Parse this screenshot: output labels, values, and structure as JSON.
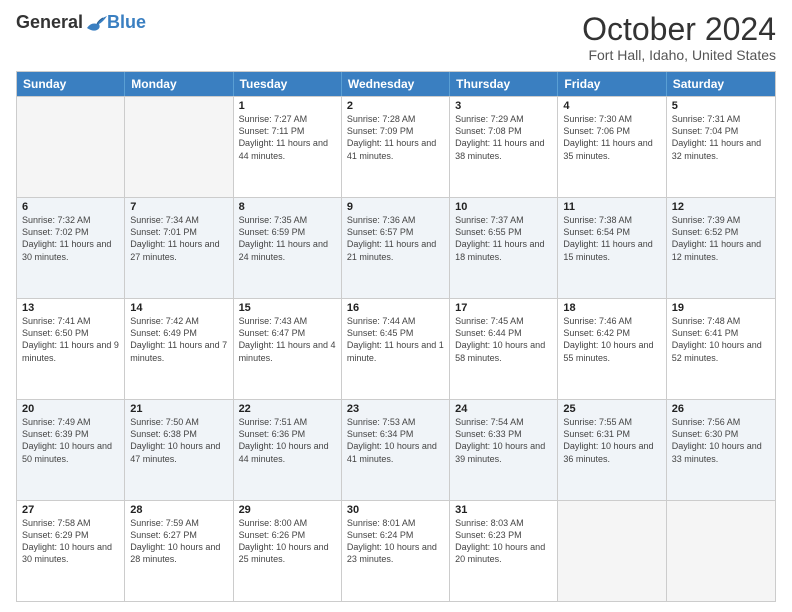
{
  "header": {
    "logo_general": "General",
    "logo_blue": "Blue",
    "title": "October 2024",
    "subtitle": "Fort Hall, Idaho, United States"
  },
  "days_of_week": [
    "Sunday",
    "Monday",
    "Tuesday",
    "Wednesday",
    "Thursday",
    "Friday",
    "Saturday"
  ],
  "weeks": [
    [
      {
        "day": "",
        "sunrise": "",
        "sunset": "",
        "daylight": "",
        "empty": true
      },
      {
        "day": "",
        "sunrise": "",
        "sunset": "",
        "daylight": "",
        "empty": true
      },
      {
        "day": "1",
        "sunrise": "Sunrise: 7:27 AM",
        "sunset": "Sunset: 7:11 PM",
        "daylight": "Daylight: 11 hours and 44 minutes.",
        "empty": false
      },
      {
        "day": "2",
        "sunrise": "Sunrise: 7:28 AM",
        "sunset": "Sunset: 7:09 PM",
        "daylight": "Daylight: 11 hours and 41 minutes.",
        "empty": false
      },
      {
        "day": "3",
        "sunrise": "Sunrise: 7:29 AM",
        "sunset": "Sunset: 7:08 PM",
        "daylight": "Daylight: 11 hours and 38 minutes.",
        "empty": false
      },
      {
        "day": "4",
        "sunrise": "Sunrise: 7:30 AM",
        "sunset": "Sunset: 7:06 PM",
        "daylight": "Daylight: 11 hours and 35 minutes.",
        "empty": false
      },
      {
        "day": "5",
        "sunrise": "Sunrise: 7:31 AM",
        "sunset": "Sunset: 7:04 PM",
        "daylight": "Daylight: 11 hours and 32 minutes.",
        "empty": false
      }
    ],
    [
      {
        "day": "6",
        "sunrise": "Sunrise: 7:32 AM",
        "sunset": "Sunset: 7:02 PM",
        "daylight": "Daylight: 11 hours and 30 minutes.",
        "empty": false
      },
      {
        "day": "7",
        "sunrise": "Sunrise: 7:34 AM",
        "sunset": "Sunset: 7:01 PM",
        "daylight": "Daylight: 11 hours and 27 minutes.",
        "empty": false
      },
      {
        "day": "8",
        "sunrise": "Sunrise: 7:35 AM",
        "sunset": "Sunset: 6:59 PM",
        "daylight": "Daylight: 11 hours and 24 minutes.",
        "empty": false
      },
      {
        "day": "9",
        "sunrise": "Sunrise: 7:36 AM",
        "sunset": "Sunset: 6:57 PM",
        "daylight": "Daylight: 11 hours and 21 minutes.",
        "empty": false
      },
      {
        "day": "10",
        "sunrise": "Sunrise: 7:37 AM",
        "sunset": "Sunset: 6:55 PM",
        "daylight": "Daylight: 11 hours and 18 minutes.",
        "empty": false
      },
      {
        "day": "11",
        "sunrise": "Sunrise: 7:38 AM",
        "sunset": "Sunset: 6:54 PM",
        "daylight": "Daylight: 11 hours and 15 minutes.",
        "empty": false
      },
      {
        "day": "12",
        "sunrise": "Sunrise: 7:39 AM",
        "sunset": "Sunset: 6:52 PM",
        "daylight": "Daylight: 11 hours and 12 minutes.",
        "empty": false
      }
    ],
    [
      {
        "day": "13",
        "sunrise": "Sunrise: 7:41 AM",
        "sunset": "Sunset: 6:50 PM",
        "daylight": "Daylight: 11 hours and 9 minutes.",
        "empty": false
      },
      {
        "day": "14",
        "sunrise": "Sunrise: 7:42 AM",
        "sunset": "Sunset: 6:49 PM",
        "daylight": "Daylight: 11 hours and 7 minutes.",
        "empty": false
      },
      {
        "day": "15",
        "sunrise": "Sunrise: 7:43 AM",
        "sunset": "Sunset: 6:47 PM",
        "daylight": "Daylight: 11 hours and 4 minutes.",
        "empty": false
      },
      {
        "day": "16",
        "sunrise": "Sunrise: 7:44 AM",
        "sunset": "Sunset: 6:45 PM",
        "daylight": "Daylight: 11 hours and 1 minute.",
        "empty": false
      },
      {
        "day": "17",
        "sunrise": "Sunrise: 7:45 AM",
        "sunset": "Sunset: 6:44 PM",
        "daylight": "Daylight: 10 hours and 58 minutes.",
        "empty": false
      },
      {
        "day": "18",
        "sunrise": "Sunrise: 7:46 AM",
        "sunset": "Sunset: 6:42 PM",
        "daylight": "Daylight: 10 hours and 55 minutes.",
        "empty": false
      },
      {
        "day": "19",
        "sunrise": "Sunrise: 7:48 AM",
        "sunset": "Sunset: 6:41 PM",
        "daylight": "Daylight: 10 hours and 52 minutes.",
        "empty": false
      }
    ],
    [
      {
        "day": "20",
        "sunrise": "Sunrise: 7:49 AM",
        "sunset": "Sunset: 6:39 PM",
        "daylight": "Daylight: 10 hours and 50 minutes.",
        "empty": false
      },
      {
        "day": "21",
        "sunrise": "Sunrise: 7:50 AM",
        "sunset": "Sunset: 6:38 PM",
        "daylight": "Daylight: 10 hours and 47 minutes.",
        "empty": false
      },
      {
        "day": "22",
        "sunrise": "Sunrise: 7:51 AM",
        "sunset": "Sunset: 6:36 PM",
        "daylight": "Daylight: 10 hours and 44 minutes.",
        "empty": false
      },
      {
        "day": "23",
        "sunrise": "Sunrise: 7:53 AM",
        "sunset": "Sunset: 6:34 PM",
        "daylight": "Daylight: 10 hours and 41 minutes.",
        "empty": false
      },
      {
        "day": "24",
        "sunrise": "Sunrise: 7:54 AM",
        "sunset": "Sunset: 6:33 PM",
        "daylight": "Daylight: 10 hours and 39 minutes.",
        "empty": false
      },
      {
        "day": "25",
        "sunrise": "Sunrise: 7:55 AM",
        "sunset": "Sunset: 6:31 PM",
        "daylight": "Daylight: 10 hours and 36 minutes.",
        "empty": false
      },
      {
        "day": "26",
        "sunrise": "Sunrise: 7:56 AM",
        "sunset": "Sunset: 6:30 PM",
        "daylight": "Daylight: 10 hours and 33 minutes.",
        "empty": false
      }
    ],
    [
      {
        "day": "27",
        "sunrise": "Sunrise: 7:58 AM",
        "sunset": "Sunset: 6:29 PM",
        "daylight": "Daylight: 10 hours and 30 minutes.",
        "empty": false
      },
      {
        "day": "28",
        "sunrise": "Sunrise: 7:59 AM",
        "sunset": "Sunset: 6:27 PM",
        "daylight": "Daylight: 10 hours and 28 minutes.",
        "empty": false
      },
      {
        "day": "29",
        "sunrise": "Sunrise: 8:00 AM",
        "sunset": "Sunset: 6:26 PM",
        "daylight": "Daylight: 10 hours and 25 minutes.",
        "empty": false
      },
      {
        "day": "30",
        "sunrise": "Sunrise: 8:01 AM",
        "sunset": "Sunset: 6:24 PM",
        "daylight": "Daylight: 10 hours and 23 minutes.",
        "empty": false
      },
      {
        "day": "31",
        "sunrise": "Sunrise: 8:03 AM",
        "sunset": "Sunset: 6:23 PM",
        "daylight": "Daylight: 10 hours and 20 minutes.",
        "empty": false
      },
      {
        "day": "",
        "sunrise": "",
        "sunset": "",
        "daylight": "",
        "empty": true
      },
      {
        "day": "",
        "sunrise": "",
        "sunset": "",
        "daylight": "",
        "empty": true
      }
    ]
  ],
  "alt_rows": [
    1,
    3
  ]
}
